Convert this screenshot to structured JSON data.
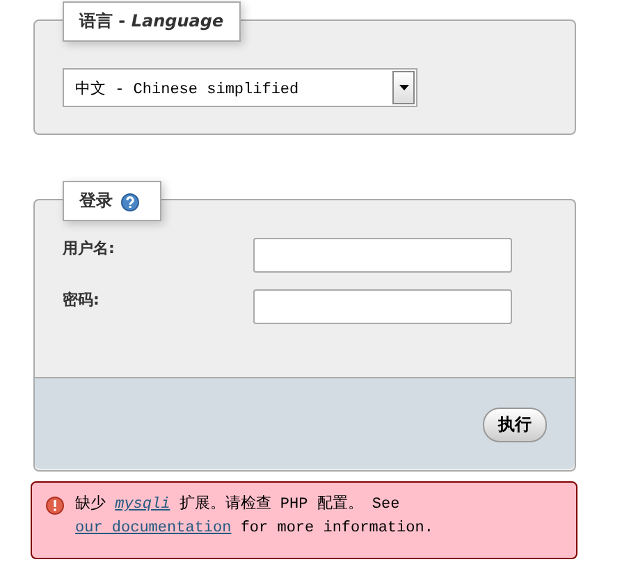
{
  "language": {
    "legend": "语言 - *Language*",
    "select": {
      "value": "中文 - Chinese simplified"
    }
  },
  "login": {
    "legend": "登录",
    "fields": [
      {
        "label": "用户名:"
      },
      {
        "label": "密码:"
      }
    ],
    "submit": "执行"
  },
  "error": {
    "segments": [
      {
        "kind": "text",
        "text": "缺少 "
      },
      {
        "kind": "code_link",
        "text": "mysqli"
      },
      {
        "kind": "text",
        "text": " 扩展。请检查 PHP 配置。 See "
      },
      {
        "kind": "link",
        "text": "our documentation"
      },
      {
        "kind": "text",
        "text": " for more information."
      }
    ]
  }
}
